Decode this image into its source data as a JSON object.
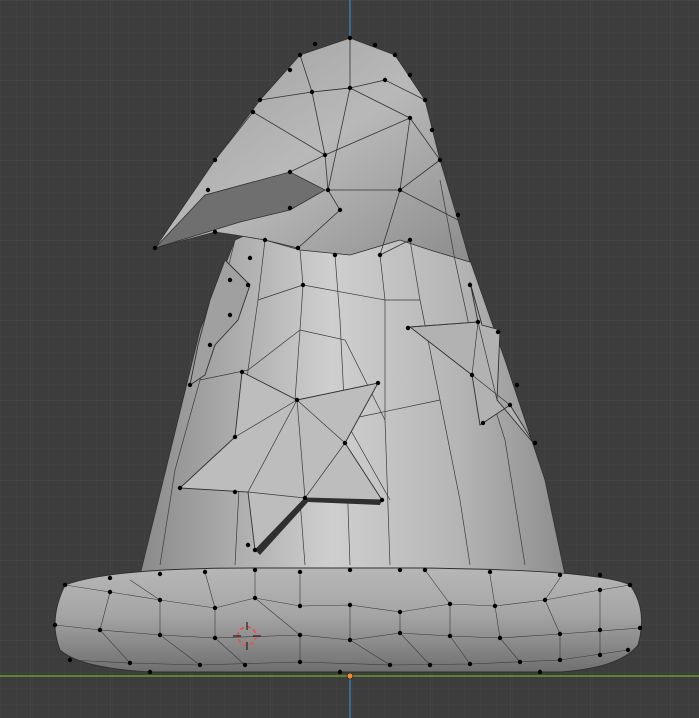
{
  "viewport": {
    "mode": "edit",
    "view": "front-orthographic",
    "object": "wizard-hat-mesh",
    "colors": {
      "background": "#3d3d3d",
      "grid_minor": "#434343",
      "grid_major": "#4a4a4a",
      "axis_x": "#6b9a2f",
      "axis_z": "#3d79b0",
      "mesh_light": "#c9c9c9",
      "mesh_mid": "#a9a9a9",
      "mesh_dark": "#7e7e7e",
      "edge": "#303030",
      "vertex": "#000000",
      "cursor_red": "#e05555",
      "origin": "#f08a2a"
    },
    "elements": [
      "3d-cursor",
      "object-origin",
      "mesh-vertices",
      "mesh-edges",
      "mesh-faces",
      "viewport-grid"
    ]
  }
}
